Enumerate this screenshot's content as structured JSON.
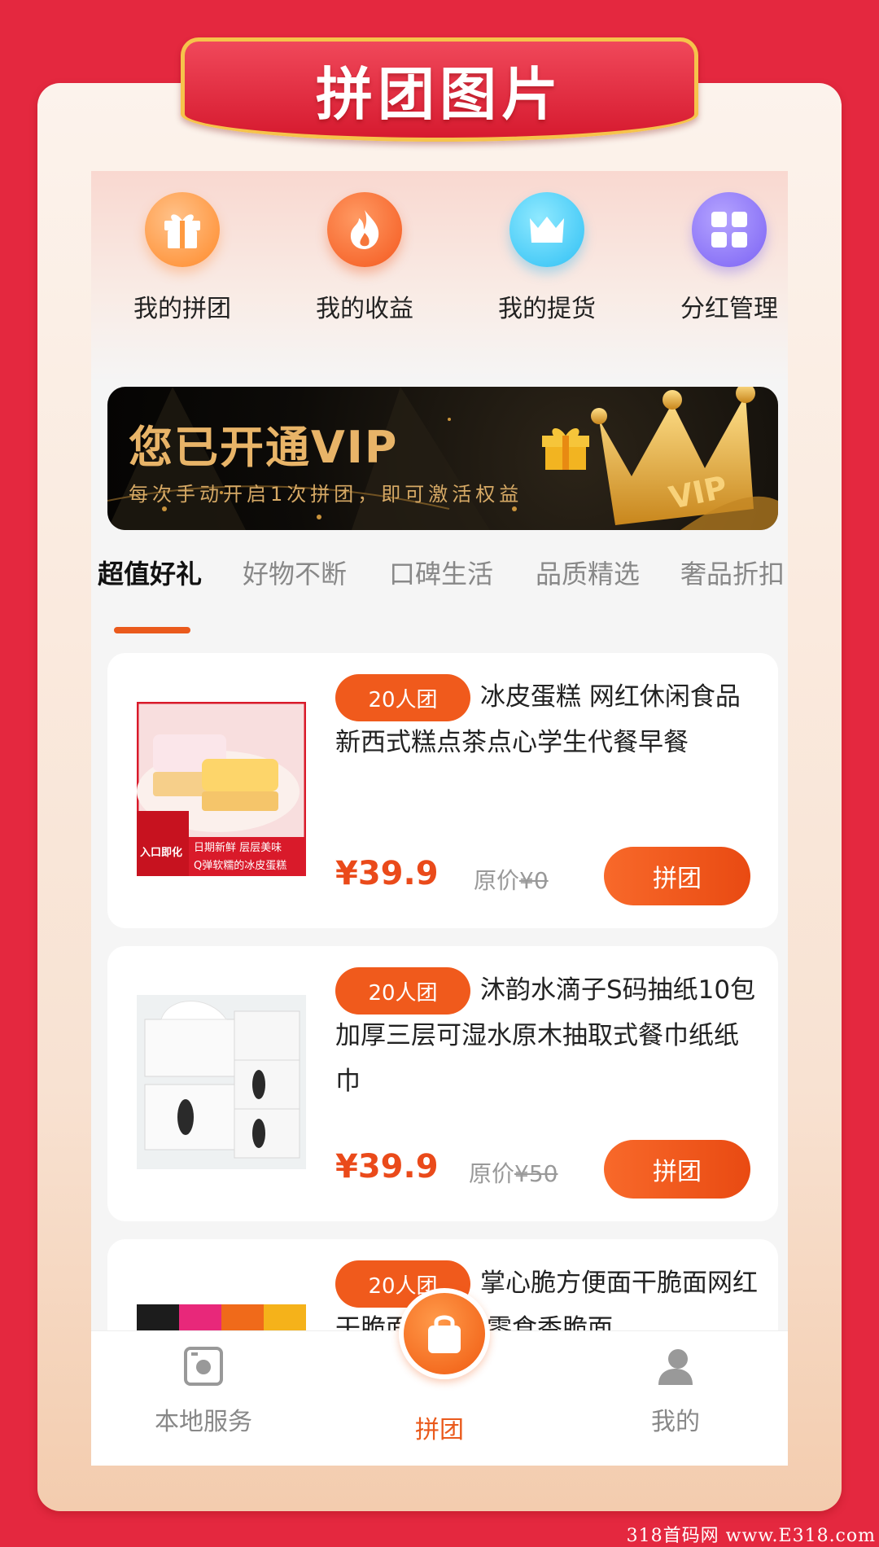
{
  "page": {
    "title": "拼团图片",
    "watermark": "318首码网 www.E318.com"
  },
  "quick_actions": [
    {
      "label": "我的拼团",
      "icon": "gift-icon",
      "color": "#ff8a2a"
    },
    {
      "label": "我的收益",
      "icon": "flame-icon",
      "color": "#f4581e"
    },
    {
      "label": "我的提货",
      "icon": "crown-icon",
      "color": "#2fc0f4"
    },
    {
      "label": "分红管理",
      "icon": "grid-icon",
      "color": "#7b62f4"
    }
  ],
  "vip_banner": {
    "title": "您已开通VIP",
    "subtitle": "每次手动开启1次拼团，即可激活权益",
    "crown_text": "VIP"
  },
  "tabs": [
    {
      "label": "超值好礼",
      "active": true
    },
    {
      "label": "好物不断",
      "active": false
    },
    {
      "label": "口碑生活",
      "active": false
    },
    {
      "label": "品质精选",
      "active": false
    },
    {
      "label": "奢品折扣",
      "active": false
    }
  ],
  "products": [
    {
      "badge": "20人团",
      "title": "冰皮蛋糕 网红休闲食品 新西式糕点茶点心学生代餐早餐",
      "price": "¥39.9",
      "orig_label": "原价",
      "orig_price": "¥0",
      "button": "拼团",
      "img_texts": [
        "日期新鲜 层层美味",
        "Q弹软糯的冰皮蛋糕",
        "入口即化"
      ]
    },
    {
      "badge": "20人团",
      "title": "沐韵水滴子S码抽纸10包 加厚三层可湿水原木抽取式餐巾纸纸巾",
      "price": "¥39.9",
      "orig_label": "原价",
      "orig_price": "¥50",
      "button": "拼团"
    },
    {
      "badge": "20人团",
      "title": "掌心脆方便面干脆面网红干脆面休闲小零食香脆面"
    }
  ],
  "bottom_nav": [
    {
      "label": "本地服务",
      "icon": "local-service-icon",
      "active": false
    },
    {
      "label": "拼团",
      "icon": "shopping-bag-icon",
      "active": true
    },
    {
      "label": "我的",
      "icon": "user-icon",
      "active": false
    }
  ],
  "colors": {
    "accent": "#ea5a1c",
    "background": "#e4283f",
    "price": "#ea4a1a"
  }
}
